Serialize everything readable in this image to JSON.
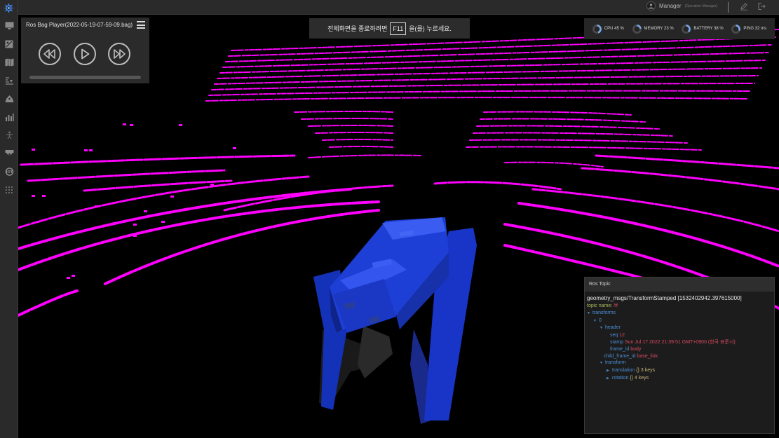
{
  "topbar": {
    "user_name": "Manager",
    "user_role": "(Operation Manager)"
  },
  "sidebar": {
    "icons": [
      "logo-icon",
      "monitor-icon",
      "map-pin-icon",
      "map-icon",
      "layers-icon",
      "robot-icon",
      "bar-chart-icon",
      "accessibility-icon",
      "camera-icon",
      "iot-icon",
      "grid-icon"
    ]
  },
  "player": {
    "title": "Ros Bag Player(2022-05-19-07-59-09.bag)",
    "progress": 0
  },
  "notice": {
    "before": "전체화면을 종료하려면",
    "key": "F11",
    "after": "을(를) 누르세요."
  },
  "stats": {
    "cpu": "CPU 45 %",
    "memory": "MEMORY 23 %",
    "battery": "BATTERY 38 %",
    "ping": "PING 32 ms",
    "cpu_level": 0.45,
    "memory_level": 0.23,
    "battery_level": 0.38,
    "ping_level": 0.32
  },
  "ros_topic": {
    "header": "Ros Topic",
    "message_type": "geometry_msgs/TransformStamped [1532402942.397615000]",
    "topic_key": "topic name:",
    "topic_value": "/tf",
    "transforms": "transforms",
    "index": "0",
    "header_key": "header",
    "seq_key": "seq",
    "seq_value": "12",
    "stamp_key": "stamp",
    "stamp_value": "Sun Jul 17 2022 21:39:51 GMT+0900 (한국 표준시)",
    "frame_id_key": "frame_id",
    "frame_id_value": "body",
    "child_frame_id_key": "child_frame_id",
    "child_frame_id_value": "base_link",
    "transform_key": "transform",
    "translation_key": "translation",
    "translation_value": "{} 3 keys",
    "rotation_key": "rotation",
    "rotation_value": "{} 4 keys"
  },
  "colors": {
    "lidar": "#ff00ff",
    "robot": "#1e3fd6",
    "panel": "#2b2b2b",
    "accent_blue": "#4a8fd6"
  }
}
